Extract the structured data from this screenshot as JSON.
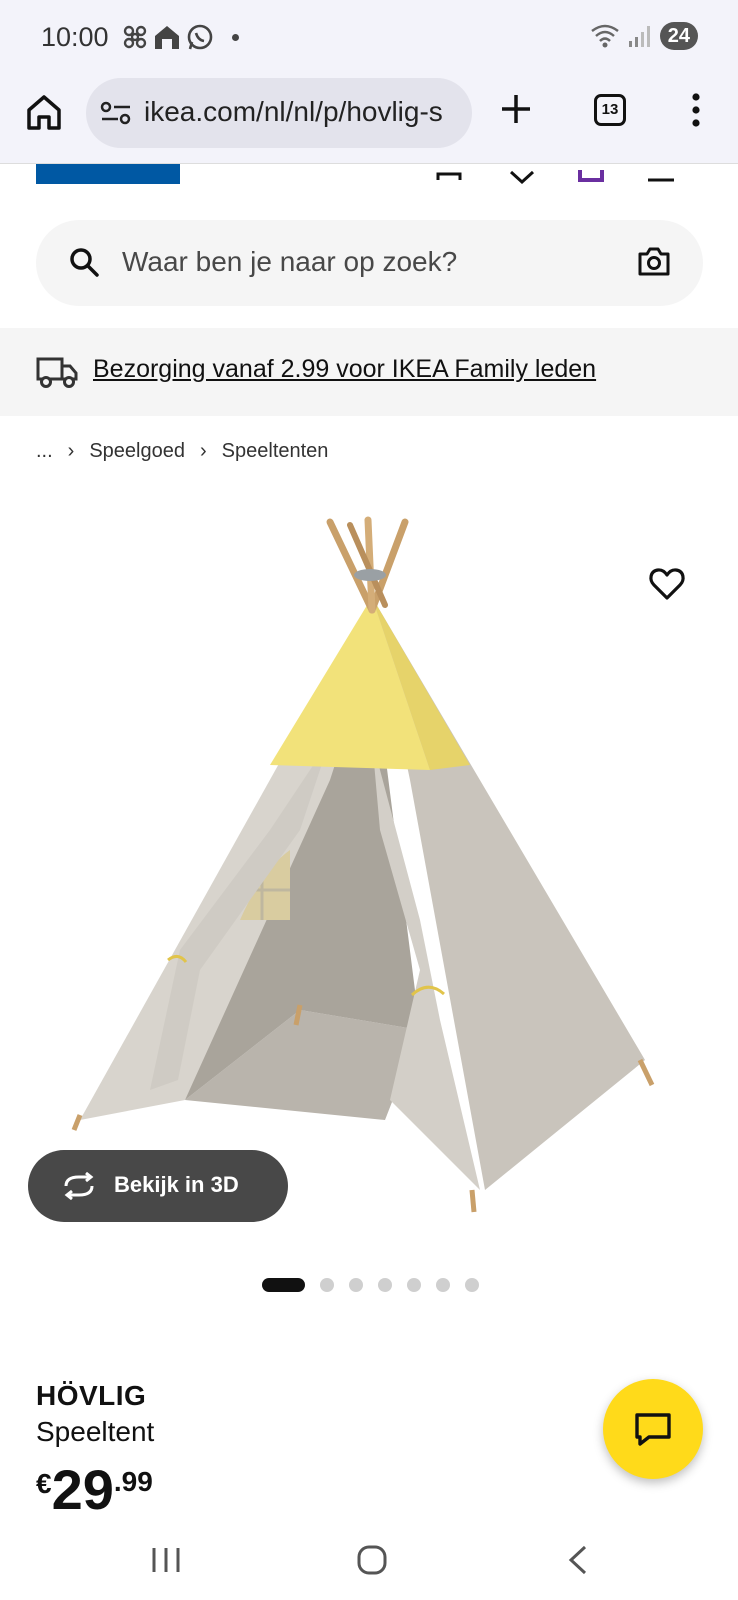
{
  "status_bar": {
    "time": "10:00",
    "battery": "24"
  },
  "browser": {
    "url": "ikea.com/nl/nl/p/hovlig-s",
    "tab_count": "13"
  },
  "search": {
    "placeholder": "Waar ben je naar op zoek?"
  },
  "delivery": {
    "text": "Bezorging vanaf 2.99 voor IKEA Family leden"
  },
  "breadcrumb": {
    "ellipsis": "...",
    "items": [
      "Speelgoed",
      "Speeltenten"
    ]
  },
  "gallery": {
    "view_3d_label": "Bekijk in 3D",
    "image_count": 7,
    "active_index": 0
  },
  "product": {
    "name": "HÖVLIG",
    "type": "Speeltent",
    "price_currency": "€",
    "price_whole": "29",
    "price_decimals": ".99"
  },
  "colors": {
    "ikea_blue": "#0058a3",
    "ikea_yellow": "#ffda1a",
    "tent_yellow": "#f2e27a",
    "tent_grey": "#cdc8c0"
  }
}
